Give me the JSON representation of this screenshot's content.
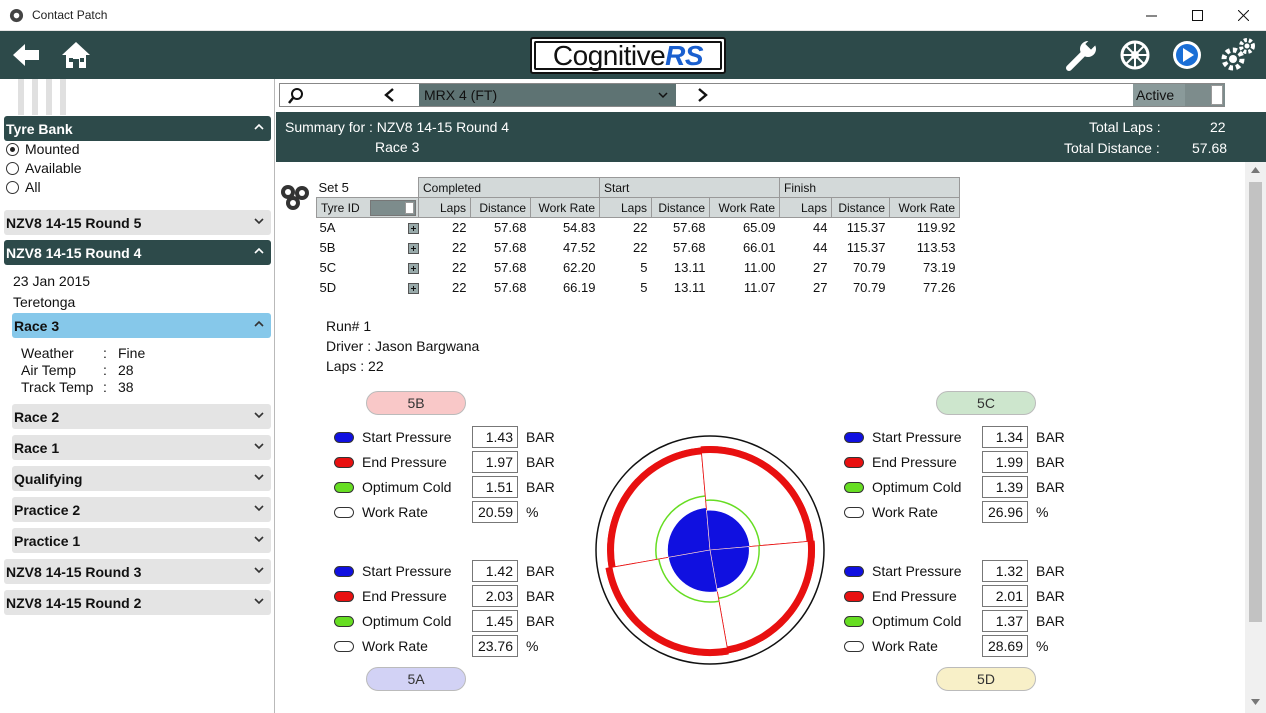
{
  "window": {
    "title": "Contact Patch"
  },
  "header": {
    "logo_a": "Cognitive",
    "logo_b": "RS"
  },
  "sidebar": {
    "tyre_bank": {
      "label": "Tyre Bank",
      "options": [
        {
          "label": "Mounted",
          "selected": true
        },
        {
          "label": "Available",
          "selected": false
        },
        {
          "label": "All",
          "selected": false
        }
      ]
    },
    "events": [
      {
        "label": "NZV8 14-15 Round 5",
        "expanded": false
      },
      {
        "label": "NZV8 14-15 Round 4",
        "expanded": true
      },
      {
        "label": "NZV8 14-15 Round 3",
        "expanded": false
      },
      {
        "label": "NZV8 14-15 Round 2",
        "expanded": false
      }
    ],
    "round4": {
      "date": "23 Jan 2015",
      "venue": "Teretonga",
      "sessions": [
        "Race 3",
        "Race 2",
        "Race 1",
        "Qualifying",
        "Practice 2",
        "Practice 1"
      ],
      "selected_session": "Race 3",
      "conditions": [
        {
          "label": "Weather",
          "sep": ":",
          "value": "Fine"
        },
        {
          "label": "Air Temp",
          "sep": ":",
          "value": "28"
        },
        {
          "label": "Track Temp",
          "sep": ":",
          "value": "38"
        }
      ]
    }
  },
  "filter": {
    "vehicle": "MRX 4 (FT)",
    "status": "Active"
  },
  "summary": {
    "for_label": "Summary for : NZV8 14-15 Round 4",
    "session": "Race 3",
    "total_laps_label": "Total Laps :",
    "total_laps": "22",
    "total_distance_label": "Total Distance :",
    "total_distance": "57.68"
  },
  "tyre_table": {
    "set": "Set 5",
    "groups": [
      "Completed",
      "Start",
      "Finish"
    ],
    "id_header": "Tyre ID",
    "cols": [
      "Laps",
      "Distance",
      "Work Rate",
      "Laps",
      "Distance",
      "Work Rate",
      "Laps",
      "Distance",
      "Work Rate"
    ],
    "rows": [
      [
        "5A",
        "22",
        "57.68",
        "54.83",
        "22",
        "57.68",
        "65.09",
        "44",
        "115.37",
        "119.92"
      ],
      [
        "5B",
        "22",
        "57.68",
        "47.52",
        "22",
        "57.68",
        "66.01",
        "44",
        "115.37",
        "113.53"
      ],
      [
        "5C",
        "22",
        "57.68",
        "62.20",
        "5",
        "13.11",
        "11.00",
        "27",
        "70.79",
        "73.19"
      ],
      [
        "5D",
        "22",
        "57.68",
        "66.19",
        "5",
        "13.11",
        "11.07",
        "27",
        "70.79",
        "77.26"
      ]
    ]
  },
  "run": {
    "run_no": "Run# 1",
    "driver": "Driver : Jason Bargwana",
    "laps": "Laps : 22"
  },
  "legend_labels": [
    "Start Pressure",
    "End Pressure",
    "Optimum Cold",
    "Work Rate"
  ],
  "colors": {
    "start": "#1010e0",
    "end": "#e81010",
    "optimum": "#66dd22",
    "work": "#ffffff",
    "accent": "#2d4a4a"
  },
  "tyres": {
    "5B": {
      "label": "5B",
      "values": [
        "1.43",
        "1.97",
        "1.51",
        "20.59"
      ],
      "units": [
        "BAR",
        "BAR",
        "BAR",
        "%"
      ]
    },
    "5C": {
      "label": "5C",
      "values": [
        "1.34",
        "1.99",
        "1.39",
        "26.96"
      ],
      "units": [
        "BAR",
        "BAR",
        "BAR",
        "%"
      ]
    },
    "5A": {
      "label": "5A",
      "values": [
        "1.42",
        "2.03",
        "1.45",
        "23.76"
      ],
      "units": [
        "BAR",
        "BAR",
        "BAR",
        "%"
      ]
    },
    "5D": {
      "label": "5D",
      "values": [
        "1.32",
        "2.01",
        "1.37",
        "28.69"
      ],
      "units": [
        "BAR",
        "BAR",
        "BAR",
        "%"
      ]
    }
  }
}
